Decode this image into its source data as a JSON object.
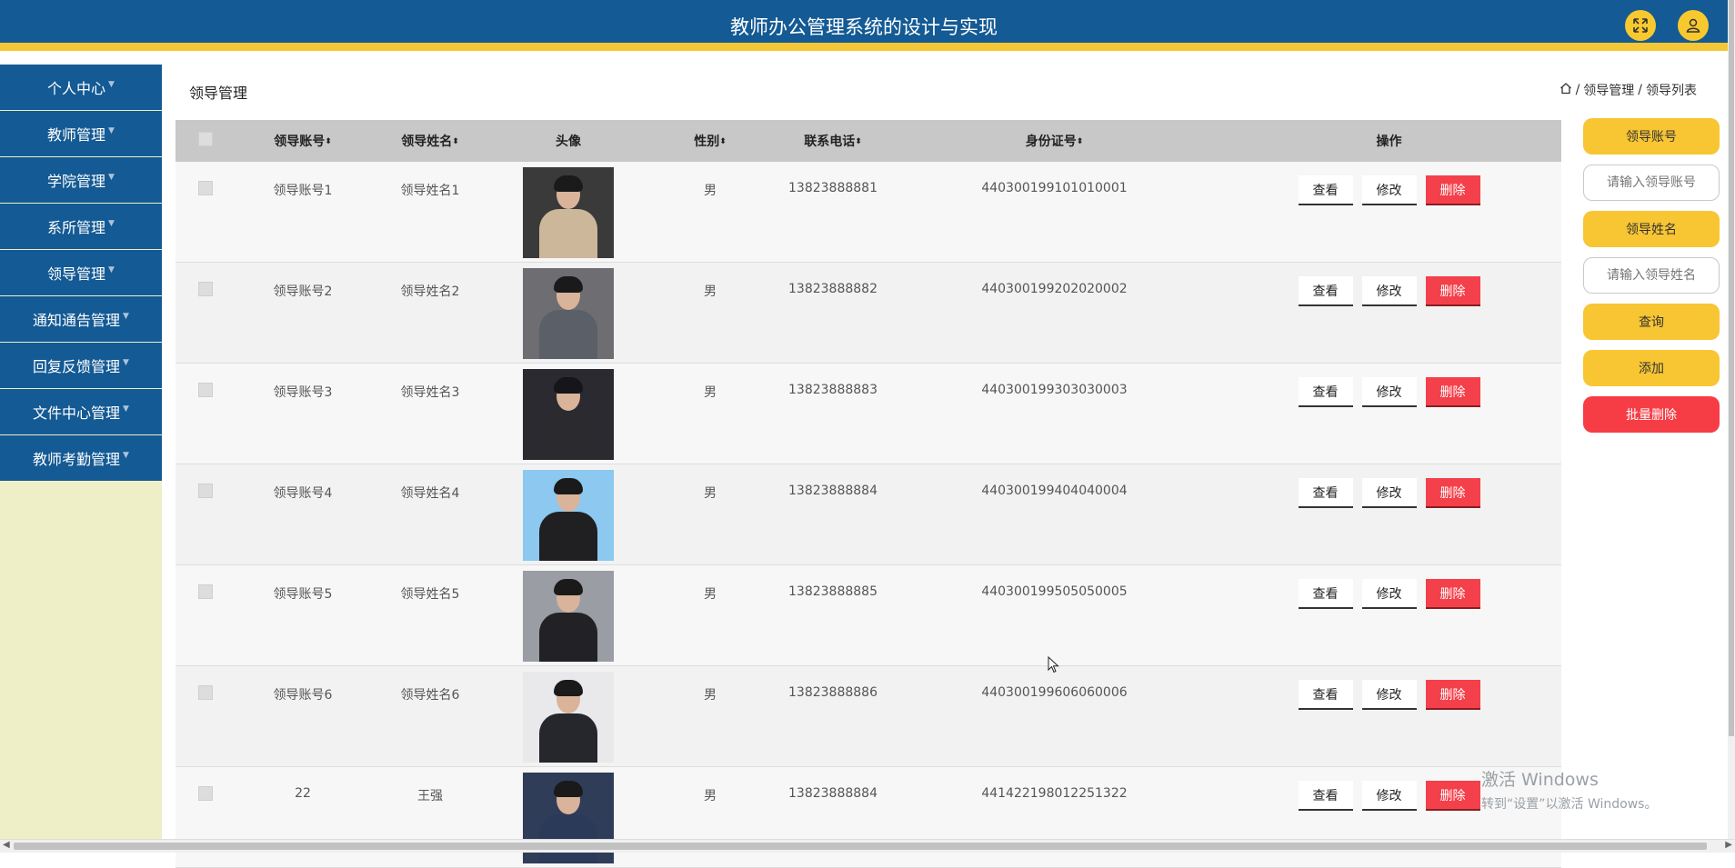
{
  "header": {
    "title": "教师办公管理系统的设计与实现",
    "fullscreen_icon": "expand-icon",
    "user_icon": "user-icon"
  },
  "sidebar": {
    "items": [
      {
        "label": "个人中心"
      },
      {
        "label": "教师管理"
      },
      {
        "label": "学院管理"
      },
      {
        "label": "系所管理"
      },
      {
        "label": "领导管理"
      },
      {
        "label": "通知通告管理"
      },
      {
        "label": "回复反馈管理"
      },
      {
        "label": "文件中心管理"
      },
      {
        "label": "教师考勤管理"
      }
    ]
  },
  "page": {
    "title": "领导管理",
    "breadcrumb": {
      "home_icon": "home-icon",
      "separator": "/",
      "level1": "领导管理",
      "level2": "领导列表"
    }
  },
  "table": {
    "headers": {
      "account": "领导账号",
      "name": "领导姓名",
      "photo": "头像",
      "sex": "性别",
      "phone": "联系电话",
      "idcard": "身份证号",
      "ops": "操作"
    },
    "sort_glyph": "⬍",
    "ops": {
      "view": "查看",
      "edit": "修改",
      "delete": "删除"
    },
    "rows": [
      {
        "account": "领导账号1",
        "name": "领导姓名1",
        "sex": "男",
        "phone": "13823888881",
        "idcard": "440300199101010001"
      },
      {
        "account": "领导账号2",
        "name": "领导姓名2",
        "sex": "男",
        "phone": "13823888882",
        "idcard": "440300199202020002"
      },
      {
        "account": "领导账号3",
        "name": "领导姓名3",
        "sex": "男",
        "phone": "13823888883",
        "idcard": "440300199303030003"
      },
      {
        "account": "领导账号4",
        "name": "领导姓名4",
        "sex": "男",
        "phone": "13823888884",
        "idcard": "440300199404040004"
      },
      {
        "account": "领导账号5",
        "name": "领导姓名5",
        "sex": "男",
        "phone": "13823888885",
        "idcard": "440300199505050005"
      },
      {
        "account": "领导账号6",
        "name": "领导姓名6",
        "sex": "男",
        "phone": "13823888886",
        "idcard": "440300199606060006"
      },
      {
        "account": "22",
        "name": "王强",
        "sex": "男",
        "phone": "13823888884",
        "idcard": "441422198012251322"
      }
    ]
  },
  "search_panel": {
    "account_label": "领导账号",
    "account_placeholder": "请输入领导账号",
    "name_label": "领导姓名",
    "name_placeholder": "请输入领导姓名",
    "query": "查询",
    "add": "添加",
    "batch_delete": "批量删除"
  },
  "watermark": {
    "line1": "激活 Windows",
    "line2": "转到“设置”以激活 Windows。"
  },
  "colors": {
    "header": "#145a94",
    "accent": "#f5c636",
    "danger": "#f4404a",
    "sidebar_bg": "#eeefc7"
  }
}
